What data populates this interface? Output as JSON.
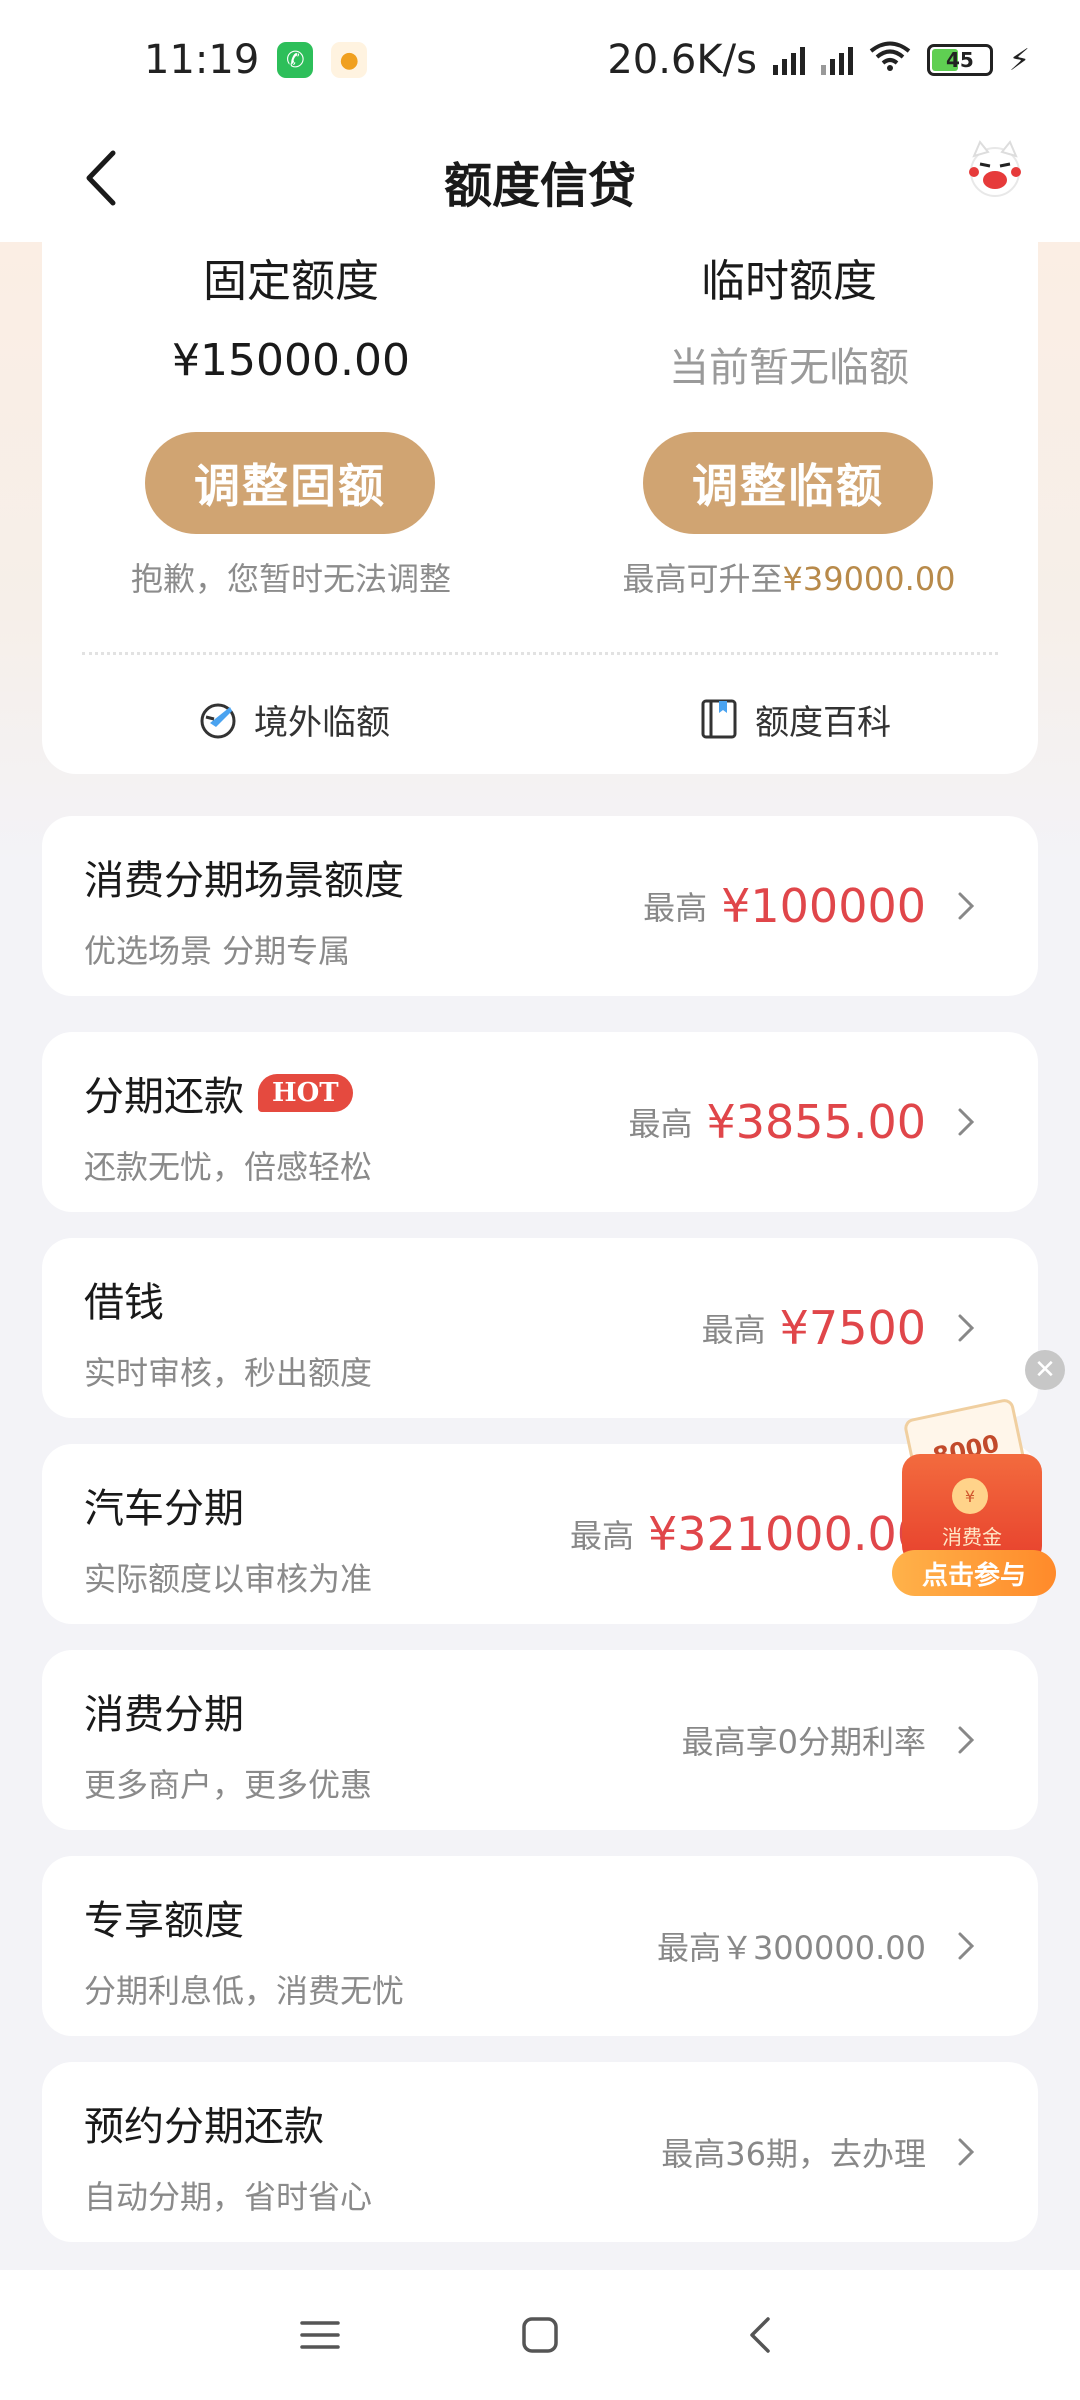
{
  "status_bar": {
    "time": "11:19",
    "network_speed": "20.6K/s",
    "battery": "45",
    "icons": [
      "call-icon",
      "app-icon",
      "hd-signal-icon",
      "signal-icon",
      "wifi-icon",
      "battery-icon",
      "charging-icon"
    ]
  },
  "header": {
    "title": "额度信贷",
    "back_icon": "back-icon",
    "mascot_icon": "mascot-icon"
  },
  "quota": {
    "fixed": {
      "label": "固定额度",
      "value": "¥15000.00",
      "button": "调整固额",
      "note": "抱歉，您暂时无法调整"
    },
    "temporary": {
      "label": "临时额度",
      "value": "当前暂无临额",
      "button": "调整临额",
      "note_prefix": "最高可升至",
      "note_amount": "¥39000.00"
    },
    "links": {
      "overseas": "境外临额",
      "encyclopedia": "额度百科"
    }
  },
  "list": [
    {
      "title": "消费分期场景额度",
      "subtitle": "优选场景 分期专属",
      "right_label": "最高",
      "right_amount": "¥100000",
      "right_text": ""
    },
    {
      "title": "分期还款",
      "badge": "HOT",
      "subtitle": "还款无忧，倍感轻松",
      "right_label": "最高",
      "right_amount": "¥3855.00",
      "right_text": ""
    },
    {
      "title": "借钱",
      "subtitle": "实时审核，秒出额度",
      "right_label": "最高",
      "right_amount": "¥7500",
      "right_text": ""
    },
    {
      "title": "汽车分期",
      "subtitle": "实际额度以审核为准",
      "right_label": "最高",
      "right_amount": "¥321000.00",
      "right_text": ""
    },
    {
      "title": "消费分期",
      "subtitle": "更多商户，更多优惠",
      "right_label": "",
      "right_amount": "",
      "right_text": "最高享0分期利率"
    },
    {
      "title": "专享额度",
      "subtitle": "分期利息低，消费无忧",
      "right_label": "",
      "right_amount": "",
      "right_text": "最高￥300000.00"
    },
    {
      "title": "预约分期还款",
      "subtitle": "自动分期，省时省心",
      "right_label": "",
      "right_amount": "",
      "right_text": "最高36期，去办理"
    }
  ],
  "promo": {
    "card_amount": "8000",
    "envelope_text": "消费金",
    "button": "点击参与"
  },
  "colors": {
    "accent_gold": "#d0a472",
    "amount_red": "#e0464a",
    "badge_red": "#e54a3f",
    "page_bg": "#f3f3f7"
  }
}
